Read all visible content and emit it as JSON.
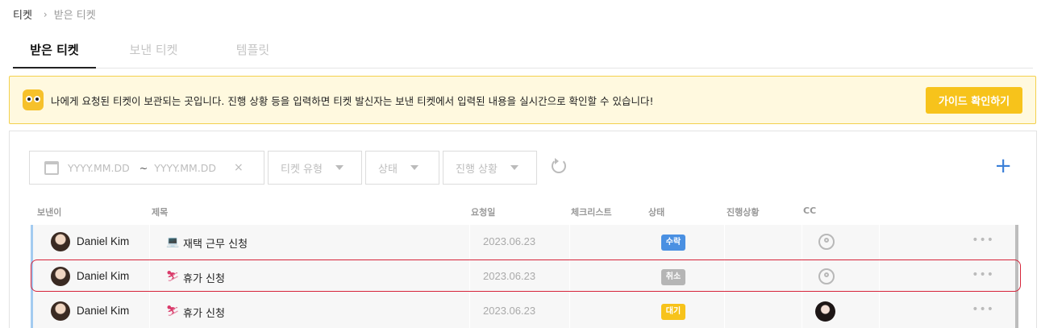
{
  "breadcrumb": {
    "root": "티켓",
    "separator": "›",
    "current": "받은 티켓"
  },
  "tabs": [
    {
      "label": "받은 티켓",
      "active": true
    },
    {
      "label": "보낸 티켓",
      "active": false
    },
    {
      "label": "템플릿",
      "active": false
    }
  ],
  "banner": {
    "icon": "eyes-icon",
    "text": "나에게 요청된 티켓이 보관되는 곳입니다. 진행 상황 등을 입력하면 티켓 발신자는 보낸 티켓에서 입력된 내용을 실시간으로 확인할 수 있습니다!",
    "button_label": "가이드 확인하기"
  },
  "filters": {
    "date_from_placeholder": "YYYY.MM.DD",
    "date_separator": "~",
    "date_to_placeholder": "YYYY.MM.DD",
    "clear": "×",
    "type_label": "티켓 유형",
    "status_label": "상태",
    "progress_label": "진행 상황",
    "add": "+"
  },
  "columns": {
    "sender": "보낸이",
    "title": "제목",
    "request_date": "요청일",
    "checklist": "체크리스트",
    "status": "상태",
    "progress": "진행상황",
    "cc": "CC"
  },
  "rows": [
    {
      "sender": "Daniel Kim",
      "title_icon": "laptop-icon",
      "title": "재택 근무 신청",
      "date": "2023.06.23",
      "status": "수락",
      "status_color": "#4a90e2",
      "cc": "empty-user-icon"
    },
    {
      "sender": "Daniel Kim",
      "title_icon": "skier-icon",
      "title": "휴가 신청",
      "date": "2023.06.23",
      "status": "취소",
      "status_color": "#b5b5b5",
      "cc": "empty-user-icon"
    },
    {
      "sender": "Daniel Kim",
      "title_icon": "skier-icon",
      "title": "휴가 신청",
      "date": "2023.06.23",
      "status": "대기",
      "status_color": "#f7c31b",
      "cc": "user-avatar"
    }
  ],
  "more_label": "•••",
  "colors": {
    "accent": "#f7c31b",
    "banner_bg": "#fff9df",
    "link_blue": "#3a7fd8",
    "highlight": "#d6243a"
  }
}
